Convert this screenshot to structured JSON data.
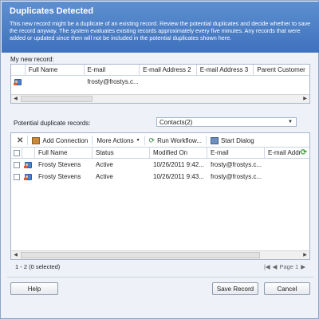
{
  "dialog": {
    "title": "Duplicates Detected",
    "message": "This new record might be a duplicate of an existing record. Review the potential duplicates and decide whether to save the record anyway. The system evaluates existing records approximately every five minutes. Any records that were added or updated since then will not be included in the potential duplicates shown here."
  },
  "new_record": {
    "label": "My new record:",
    "columns": [
      "Full Name",
      "E-mail",
      "E-mail Address 2",
      "E-mail Address 3",
      "Parent Customer"
    ],
    "row": {
      "full_name": "",
      "email": "frosty@frostys.c...",
      "email2": "",
      "email3": "",
      "parent": ""
    }
  },
  "duplicates": {
    "label": "Potential duplicate records:",
    "view_select": "Contacts(2)",
    "toolbar": {
      "delete_icon": "delete-icon",
      "add_connection": "Add Connection",
      "more_actions": "More Actions",
      "run_workflow": "Run Workflow...",
      "start_dialog": "Start Dialog"
    },
    "columns": [
      "Full Name",
      "Status",
      "Modified On",
      "E-mail",
      "E-mail Addre"
    ],
    "rows": [
      {
        "full_name": "Frosty Stevens",
        "status": "Active",
        "modified_on": "10/26/2011 9:42...",
        "email": "frosty@frostys.c..."
      },
      {
        "full_name": "Frosty Stevens",
        "status": "Active",
        "modified_on": "10/26/2011 9:43...",
        "email": "frosty@frostys.c..."
      }
    ],
    "record_count": "1 - 2 (0 selected)",
    "page_label": "Page 1"
  },
  "buttons": {
    "help": "Help",
    "save_record": "Save Record",
    "cancel": "Cancel"
  },
  "colors": {
    "header": "#4a7fc6",
    "border": "#a5b5cc",
    "refresh": "#3aa23a"
  }
}
